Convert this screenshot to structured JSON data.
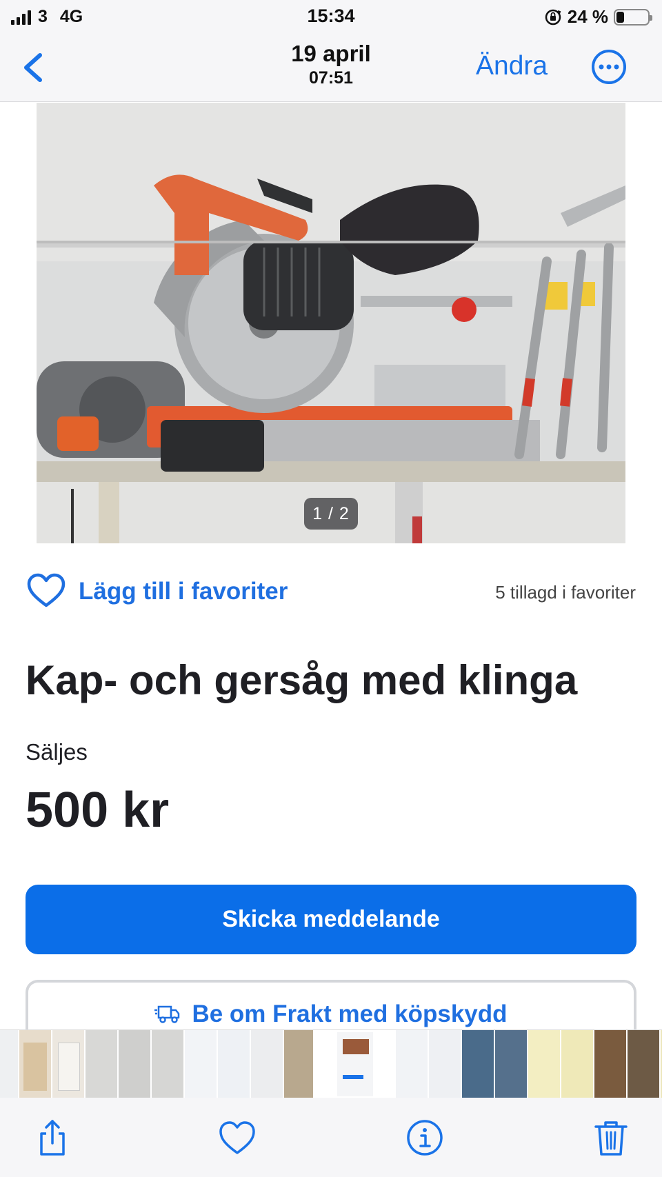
{
  "status_bar": {
    "carrier": "3",
    "network": "4G",
    "time": "15:34",
    "battery_percent": "24 %",
    "battery_level": 0.24
  },
  "nav": {
    "date": "19 april",
    "time": "07:51",
    "edit_label": "Ändra",
    "back_icon": "chevron-left-icon",
    "more_icon": "ellipsis-circle-icon"
  },
  "photo": {
    "counter": "1 / 2"
  },
  "favorites": {
    "label": "Lägg till i favoriter",
    "count_text": "5 tillagd i favoriter"
  },
  "listing": {
    "title": "Kap- och gersåg med klinga",
    "type": "Säljes",
    "price": "500 kr"
  },
  "actions": {
    "message_label": "Skicka meddelande",
    "freight_label": "Be om Frakt med köpskydd"
  },
  "toolbar": {
    "icons": [
      "share-icon",
      "heart-icon",
      "info-icon",
      "trash-icon"
    ]
  },
  "colors": {
    "accent": "#1a73e8",
    "button_blue": "#0b6ee8",
    "text": "#1f1f24",
    "bar_background": "#f6f6f8"
  }
}
